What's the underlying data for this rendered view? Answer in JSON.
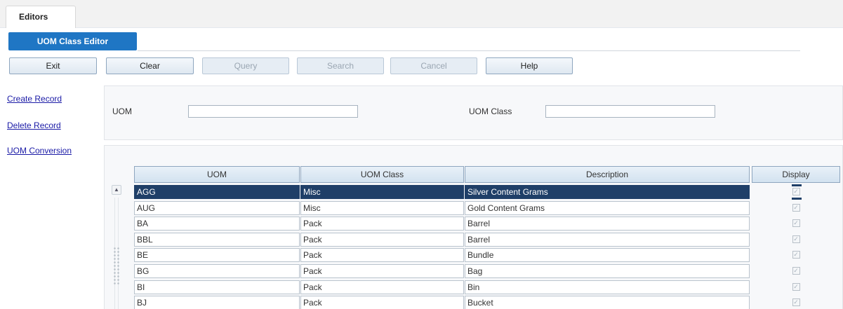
{
  "app": {
    "tab_label": "Editors"
  },
  "editor_tab": {
    "label": "UOM Class Editor"
  },
  "toolbar": {
    "exit": "Exit",
    "clear": "Clear",
    "query": "Query",
    "search": "Search",
    "cancel": "Cancel",
    "help": "Help"
  },
  "side_links": {
    "create": "Create Record",
    "delete": "Delete Record",
    "conversion": "UOM Conversion"
  },
  "query": {
    "uom_label": "UOM",
    "uom_value": "",
    "class_label": "UOM Class",
    "class_value": ""
  },
  "grid": {
    "headers": {
      "uom": "UOM",
      "uom_class": "UOM Class",
      "description": "Description",
      "display": "Display"
    },
    "rows": [
      {
        "uom": "AGG",
        "uom_class": "Misc",
        "description": "Silver Content Grams",
        "display": true,
        "selected": true
      },
      {
        "uom": "AUG",
        "uom_class": "Misc",
        "description": "Gold Content Grams",
        "display": true,
        "selected": false
      },
      {
        "uom": "BA",
        "uom_class": "Pack",
        "description": "Barrel",
        "display": true,
        "selected": false
      },
      {
        "uom": "BBL",
        "uom_class": "Pack",
        "description": "Barrel",
        "display": true,
        "selected": false
      },
      {
        "uom": "BE",
        "uom_class": "Pack",
        "description": "Bundle",
        "display": true,
        "selected": false
      },
      {
        "uom": "BG",
        "uom_class": "Pack",
        "description": "Bag",
        "display": true,
        "selected": false
      },
      {
        "uom": "BI",
        "uom_class": "Pack",
        "description": "Bin",
        "display": true,
        "selected": false
      },
      {
        "uom": "BJ",
        "uom_class": "Pack",
        "description": "Bucket",
        "display": true,
        "selected": false
      }
    ]
  },
  "colors": {
    "accent": "#1f76c4",
    "selected_row": "#1f3f68",
    "link": "#1a1aa6"
  }
}
